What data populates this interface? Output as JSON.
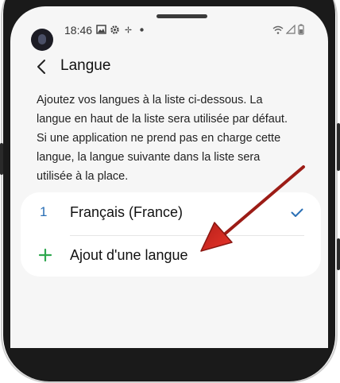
{
  "status_bar": {
    "time": "18:46",
    "icons": [
      "image-icon",
      "settings-gear-icon",
      "fan-icon",
      "dot-icon"
    ],
    "right_icons": [
      "wifi-icon",
      "signal-icon",
      "battery-icon"
    ]
  },
  "header": {
    "back_icon": "chevron-left-icon",
    "title": "Langue"
  },
  "description": "Ajoutez vos langues à la liste ci-dessous. La\nlangue en haut de la liste sera utilisée par défaut.\nSi une application ne prend pas en charge cette\nlangue, la langue suivante dans la liste sera\nutilisée à la place.",
  "languages": [
    {
      "number": "1",
      "label": "Français (France)",
      "selected": true
    }
  ],
  "add_language": {
    "icon": "plus-icon",
    "label": "Ajout d'une langue"
  },
  "colors": {
    "accent": "#2a6fb5",
    "plus": "#2fa84f",
    "arrow": "#d8281f"
  }
}
